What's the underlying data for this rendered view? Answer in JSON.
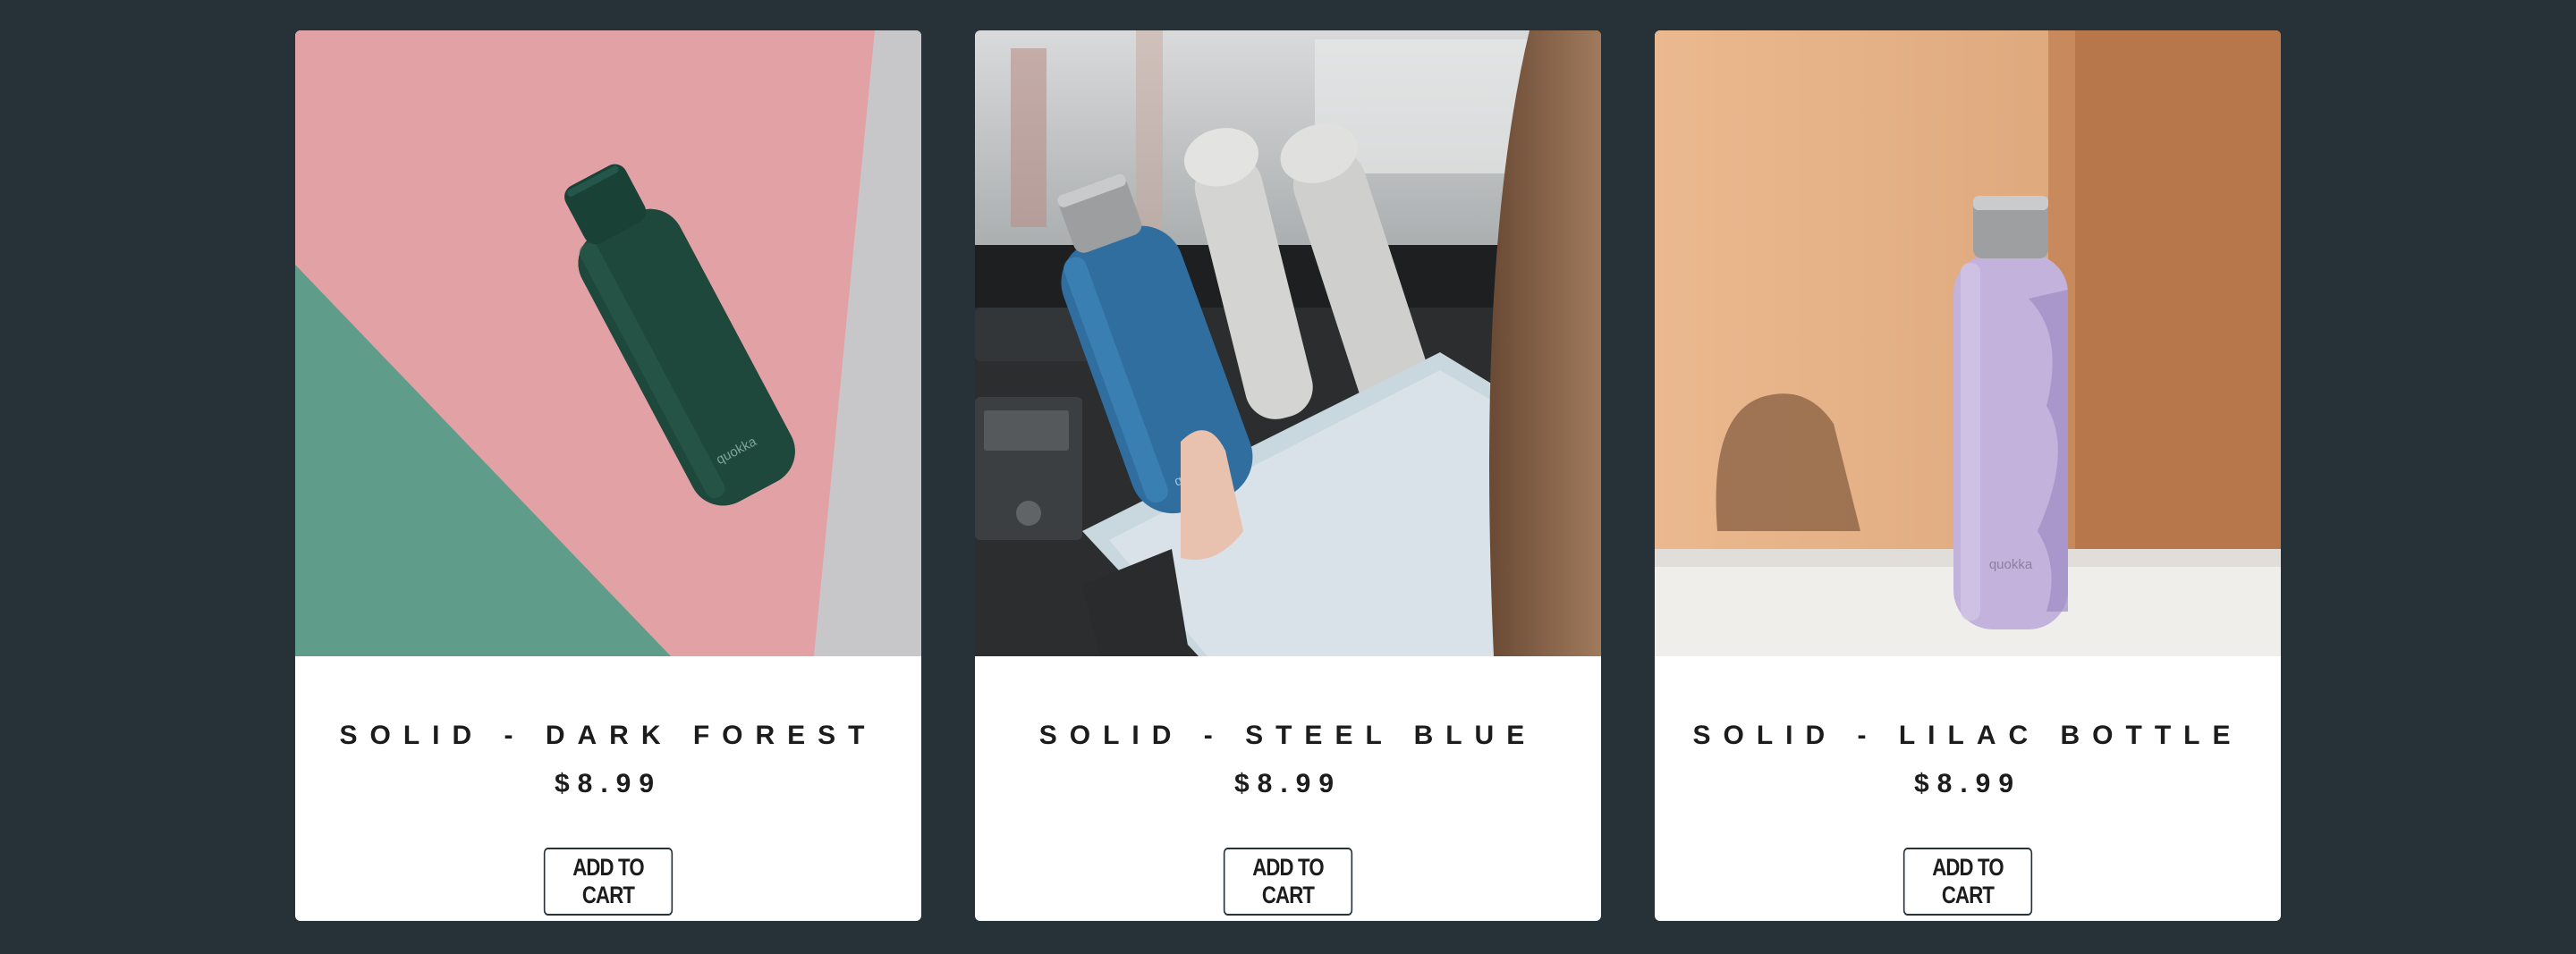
{
  "colors": {
    "page_background": "#263238",
    "card_background": "#ffffff",
    "text": "#1c1c1c"
  },
  "products": [
    {
      "title": "SOLID - DARK FOREST",
      "price": "$8.99",
      "button_label": "ADD TO CART",
      "bottle_brand": "quokka",
      "bottle_color": "#1e4a3d"
    },
    {
      "title": "SOLID - STEEL BLUE",
      "price": "$8.99",
      "button_label": "ADD TO CART",
      "bottle_brand": "quokka",
      "bottle_color": "#2f6e9e"
    },
    {
      "title": "SOLID - LILAC BOTTLE",
      "price": "$8.99",
      "button_label": "ADD TO CART",
      "bottle_brand": "quokka",
      "bottle_color": "#c2b2dc"
    }
  ]
}
